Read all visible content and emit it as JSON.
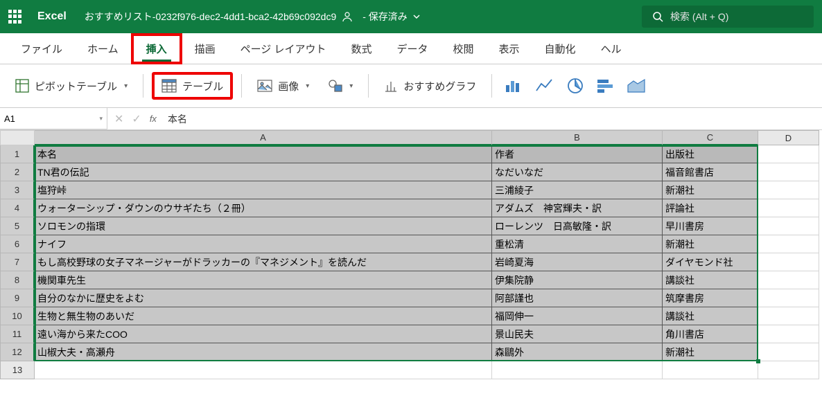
{
  "header": {
    "app_name": "Excel",
    "doc_title": "おすすめリスト-0232f976-dec2-4dd1-bca2-42b69c092dc9",
    "save_status": "- 保存済み",
    "search_placeholder": "検索 (Alt + Q)"
  },
  "tabs": [
    "ファイル",
    "ホーム",
    "挿入",
    "描画",
    "ページ レイアウト",
    "数式",
    "データ",
    "校閲",
    "表示",
    "自動化",
    "ヘル"
  ],
  "active_tab_index": 2,
  "ribbon": {
    "pivot_table": "ピボットテーブル",
    "table": "テーブル",
    "image": "画像",
    "recommended_charts": "おすすめグラフ"
  },
  "formula_bar": {
    "name_box": "A1",
    "value": "本名"
  },
  "columns": [
    "A",
    "B",
    "C",
    "D"
  ],
  "row_numbers": [
    "1",
    "2",
    "3",
    "4",
    "5",
    "6",
    "7",
    "8",
    "9",
    "10",
    "11",
    "12",
    "13"
  ],
  "data": {
    "headers": [
      "本名",
      "作者",
      "出版社"
    ],
    "rows": [
      [
        "TN君の伝記",
        "なだいなだ",
        "福音館書店"
      ],
      [
        "塩狩峠",
        "三浦綾子",
        "新潮社"
      ],
      [
        "ウォーターシップ・ダウンのウサギたち（２冊）",
        "アダムズ　神宮輝夫・訳",
        "評論社"
      ],
      [
        "ソロモンの指環",
        "ローレンツ　日高敏隆・訳",
        "早川書房"
      ],
      [
        "ナイフ",
        "重松清",
        "新潮社"
      ],
      [
        "もし高校野球の女子マネージャーがドラッカーの『マネジメント』を読んだ",
        "岩崎夏海",
        "ダイヤモンド社"
      ],
      [
        "機関車先生",
        "伊集院静",
        "講談社"
      ],
      [
        "自分のなかに歴史をよむ",
        "阿部謹也",
        "筑摩書房"
      ],
      [
        "生物と無生物のあいだ",
        "福岡伸一",
        "講談社"
      ],
      [
        "遠い海から来たCOO",
        "景山民夫",
        "角川書店"
      ],
      [
        "山椒大夫・高瀬舟",
        "森鷗外",
        "新潮社"
      ]
    ]
  }
}
